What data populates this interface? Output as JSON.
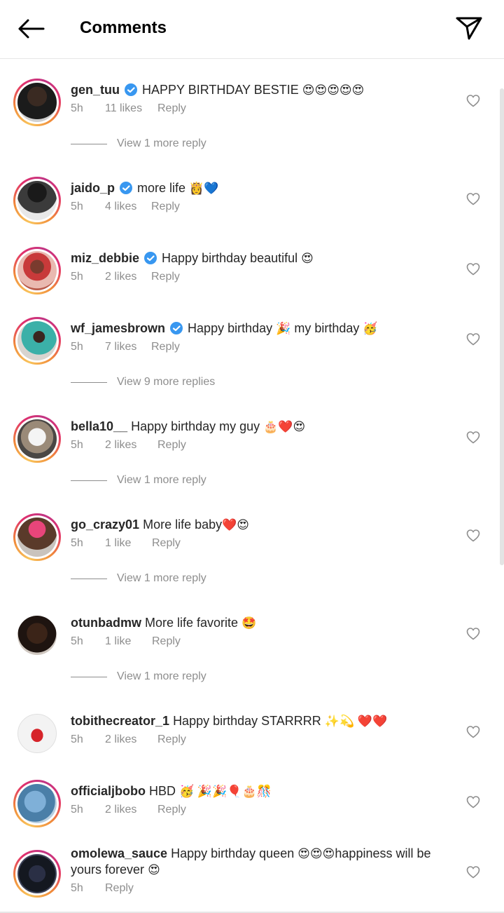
{
  "header": {
    "title": "Comments"
  },
  "icons": {
    "back": "arrow-left-icon",
    "share": "send-icon",
    "like": "heart-outline-icon",
    "verified": "verified-badge-icon"
  },
  "colors": {
    "verified": "#3897f0",
    "ring_start": "#f9c35a",
    "ring_end": "#c13584",
    "muted": "#8e8e8e"
  },
  "comments": [
    {
      "username": "gen_tuu",
      "verified": true,
      "text": "HAPPY BIRTHDAY BESTIE",
      "emoji": "😍😍😍😍😍",
      "time": "5h",
      "likes": "11 likes",
      "reply": "Reply"
    },
    {
      "username": "jaido_p",
      "verified": true,
      "text": "more life",
      "emoji": "👸💙",
      "time": "5h",
      "likes": "4 likes",
      "reply": "Reply"
    },
    {
      "username": "miz_debbie",
      "verified": true,
      "text": "Happy birthday beautiful",
      "emoji": "😍",
      "time": "5h",
      "likes": "2 likes",
      "reply": "Reply"
    },
    {
      "username": "wf_jamesbrown",
      "verified": true,
      "text": "Happy birthday",
      "emoji": "🎉",
      "text2": "my birthday",
      "emoji2": "🥳",
      "time": "5h",
      "likes": "7 likes",
      "reply": "Reply"
    },
    {
      "username": "bella10__",
      "verified": false,
      "text": "Happy birthday my guy",
      "emoji": "🎂❤️😍",
      "time": "5h",
      "likes": "2 likes",
      "reply": "Reply"
    },
    {
      "username": "go_crazy01",
      "verified": false,
      "text": "More life baby",
      "emoji": "❤️😍",
      "time": "5h",
      "likes": "1 like",
      "reply": "Reply"
    },
    {
      "username": "otunbadmw",
      "verified": false,
      "text": "More life favorite",
      "emoji": "🤩",
      "time": "5h",
      "likes": "1 like",
      "reply": "Reply"
    },
    {
      "username": "tobithecreator_1",
      "verified": false,
      "text": "Happy birthday STARRRR",
      "emoji": "✨💫 ❤️❤️",
      "time": "5h",
      "likes": "2 likes",
      "reply": "Reply"
    },
    {
      "username": "officialjbobo",
      "verified": false,
      "text": "HBD",
      "emoji": "🥳 🎉🎉🎈🎂🎊",
      "time": "5h",
      "likes": "2 likes",
      "reply": "Reply"
    },
    {
      "username": "omolewa_sauce",
      "verified": false,
      "text": "Happy birthday queen",
      "emoji": "😍😍😍",
      "text2": "happiness will be yours forever",
      "emoji2": "😍",
      "time": "5h",
      "reply": "Reply"
    }
  ],
  "view_more": {
    "r1": "View 1 more reply",
    "r4": "View 9 more replies",
    "r5": "View 1 more reply",
    "r6": "View 1 more reply",
    "r7": "View 1 more reply"
  }
}
